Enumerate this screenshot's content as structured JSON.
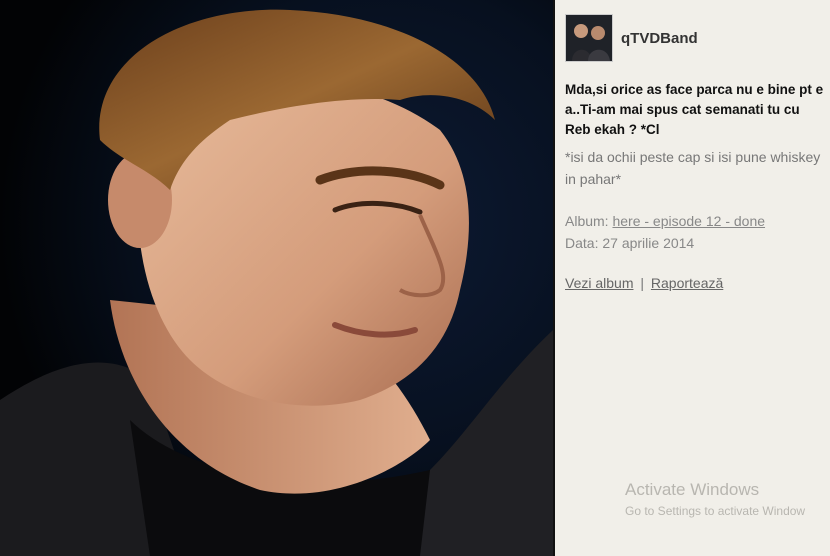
{
  "post": {
    "username": "qTVDBand",
    "caption": "Mda,si orice as face parca nu e bine pt e a..Ti-am mai spus cat semanati tu cu Reb ekah ? *Cl",
    "action": "*isi da ochii peste cap si isi pune whiskey in pahar*",
    "album_label": "Album:",
    "album_name": "here - episode 12 - done",
    "date_label": "Data:",
    "date_value": "27 aprilie 2014",
    "view_album": "Vezi album",
    "separator": "|",
    "report": "Raportează"
  },
  "watermark": {
    "title": "Activate Windows",
    "subtitle": "Go to Settings to activate Window"
  },
  "colors": {
    "photo_background": "#05070c",
    "panel_background": "#f1efe9",
    "skin": "#d8a889",
    "hair": "#8a5a2c",
    "jacket": "#1b1b1e"
  }
}
